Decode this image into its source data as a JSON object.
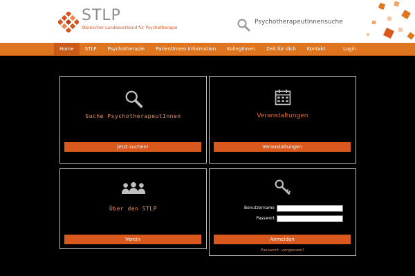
{
  "header": {
    "logo_title": "STLP",
    "logo_subtitle": "Steirischer Landesverband für Psychotherapie",
    "search_label": "PsychotherapeutInnensuche"
  },
  "nav": {
    "items": [
      {
        "label": "Home",
        "active": true
      },
      {
        "label": "STLP"
      },
      {
        "label": "Psychotherapie"
      },
      {
        "label": "PatientInnen Information"
      },
      {
        "label": "KollegInnen"
      },
      {
        "label": "Zeit für dich"
      },
      {
        "label": "Kontakt"
      }
    ],
    "login_label": "Login"
  },
  "panels": {
    "search": {
      "title": "Suche PsychotherapeutInnen",
      "button": "jetzt suchen!"
    },
    "events": {
      "title": "Veranstaltungen",
      "button": "Veranstaltungen"
    },
    "about": {
      "title": "Über den STLP",
      "button": "Verein"
    },
    "login": {
      "username_label": "Benutzername",
      "password_label": "Passwort",
      "button": "Anmelden",
      "forgot": "Passwort vergessen?"
    }
  },
  "colors": {
    "accent": "#e0751f",
    "button": "#d9581e",
    "title_text": "#f0956b"
  }
}
